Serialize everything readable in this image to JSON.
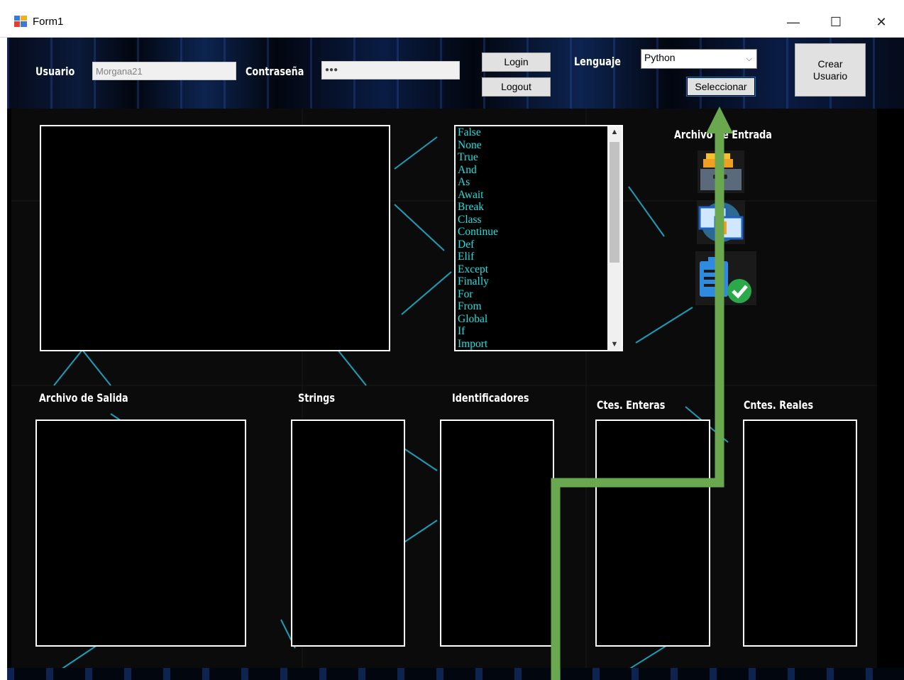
{
  "window": {
    "title": "Form1",
    "minimize": "—",
    "maximize": "☐",
    "close": "✕"
  },
  "labels": {
    "usuario": "Usuario",
    "contrasena": "Contraseña",
    "lenguaje": "Lenguaje",
    "archivo_entrada": "Archivo de Entrada",
    "archivo_salida": "Archivo de Salida",
    "strings": "Strings",
    "identificadores": "Identificadores",
    "ctes_enteras": "Ctes. Enteras",
    "cntes_reales": "Cntes. Reales"
  },
  "fields": {
    "usuario_value": "Morgana21",
    "contrasena_value": "●●●"
  },
  "buttons": {
    "login": "Login",
    "logout": "Logout",
    "seleccionar": "Seleccionar",
    "crear_usuario": "Crear Usuario"
  },
  "combo": {
    "selected": "Python",
    "arrow": "⌵"
  },
  "keywords": [
    "False",
    "None",
    "True",
    "And",
    "As",
    "Await",
    "Break",
    "Class",
    "Continue",
    "Def",
    "Elif",
    "Except",
    "Finally",
    "For",
    "From",
    "Global",
    "If",
    "Import"
  ],
  "scrollbar": {
    "up": "▲",
    "down": "▼"
  },
  "colors": {
    "keyword_text": "#22e0e0",
    "annotation_arrow": "#6aa84f",
    "form_bg": "#000000"
  }
}
